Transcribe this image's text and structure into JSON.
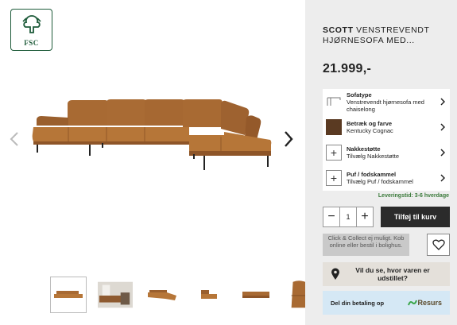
{
  "certification": {
    "label": "FSC"
  },
  "product": {
    "brand": "SCOTT",
    "name": "VENSTREVENDT HJØRNESOFA MED...",
    "price": "21.999,-"
  },
  "options": [
    {
      "title": "Sofatype",
      "value": "Venstrevendt hjørnesofa med chaiselong",
      "icon": "sofa-outline-icon"
    },
    {
      "title": "Betræk og farve",
      "value": "Kentucky Cognac",
      "icon": "color-swatch",
      "color": "#5a3a22"
    },
    {
      "title": "Nakkestøtte",
      "value": "Tilvælg Nakkestøtte",
      "icon": "plus-icon"
    },
    {
      "title": "Puf / fodskammel",
      "value": "Tilvælg Puf / fodskammel",
      "icon": "plus-icon"
    }
  ],
  "delivery": {
    "text": "Leveringstid: 3-6 hverdage"
  },
  "quantity": {
    "value": "1",
    "minus": "−",
    "plus": "+"
  },
  "cart": {
    "add_label": "Tilføj til kurv"
  },
  "click_collect": {
    "text": "Click & Collect ej muligt. Kob online eller bestil i bolighus."
  },
  "store": {
    "text": "Vil du se, hvor varen er udstillet?"
  },
  "financing": {
    "text": "Del din betaling op",
    "provider": "Resurs"
  },
  "colors": {
    "accent_dark": "#2b2b2b",
    "panel_bg": "#ededed",
    "delivery_green": "#3a7a3a",
    "leather": "#a0652e"
  }
}
